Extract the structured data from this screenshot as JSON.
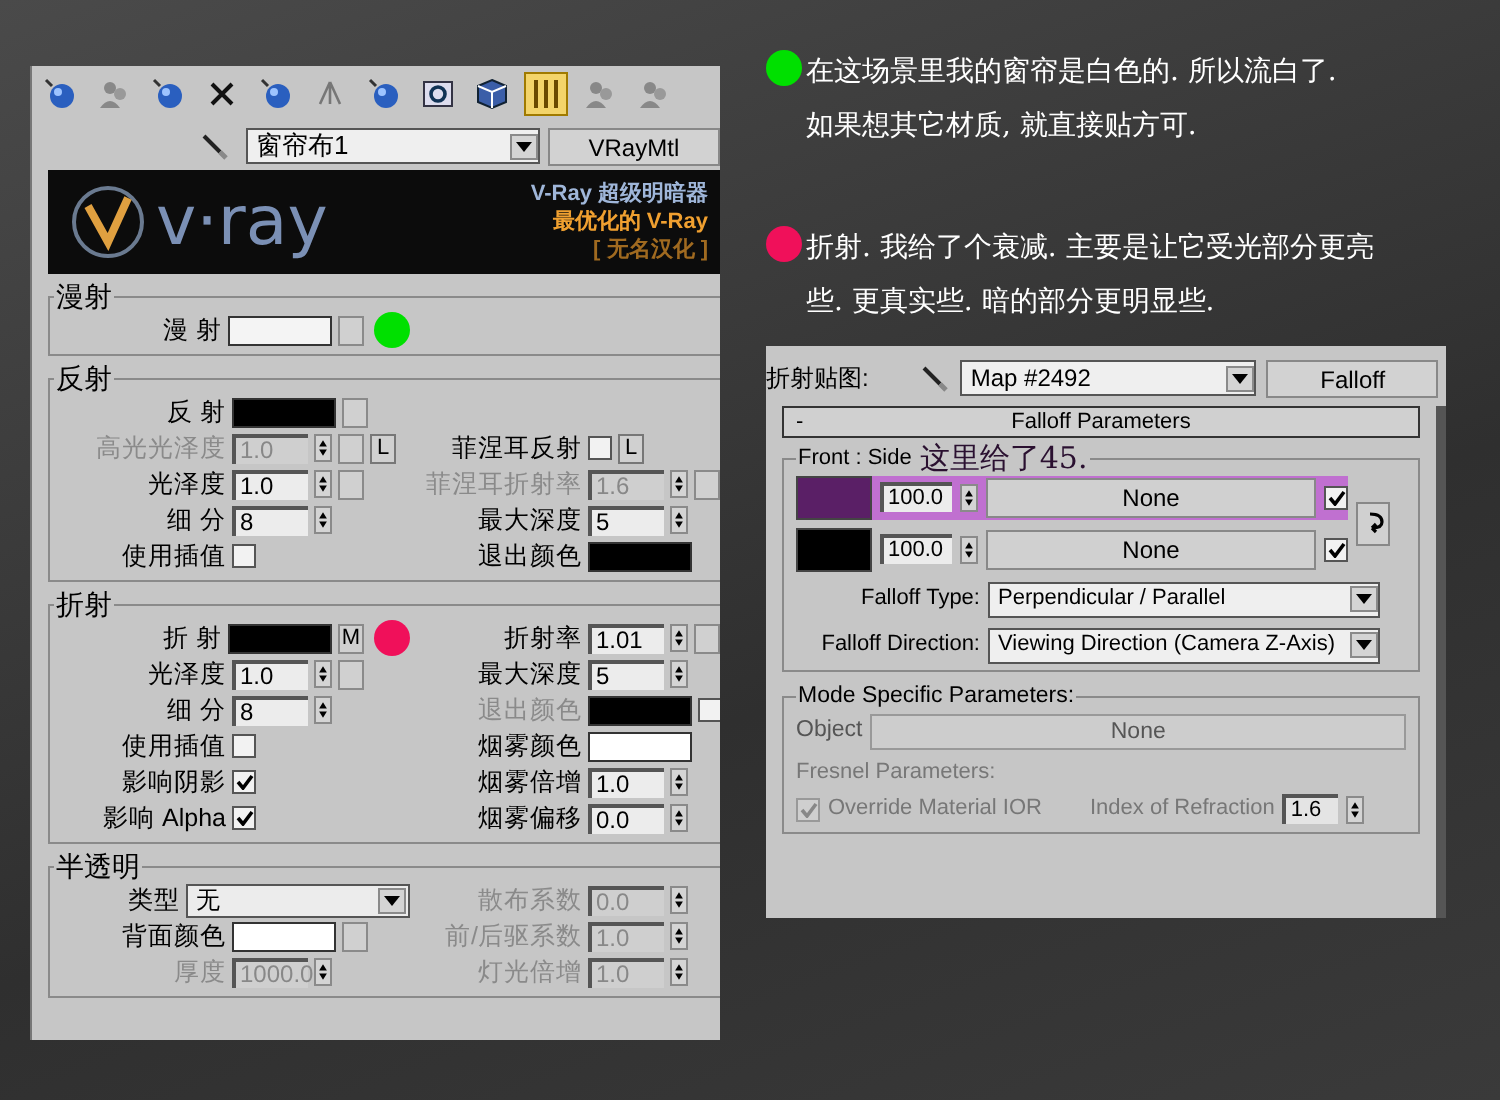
{
  "notes": [
    {
      "color": "#00e000",
      "lines": [
        "在这场景里我的窗帘是白色的. 所以流白了.",
        "如果想其它材质, 就直接贴方可."
      ]
    },
    {
      "color": "#f0105a",
      "lines": [
        "折射. 我给了个衰减. 主要是让它受光部分更亮",
        "些. 更真实些. 暗的部分更明显些."
      ]
    }
  ],
  "toolbar": [
    {
      "kind": "sphere",
      "selected": false
    },
    {
      "kind": "people",
      "selected": false
    },
    {
      "kind": "sphere",
      "selected": false
    },
    {
      "kind": "delete",
      "selected": false
    },
    {
      "kind": "sphere",
      "selected": false
    },
    {
      "kind": "tree",
      "selected": false
    },
    {
      "kind": "sphere",
      "selected": false
    },
    {
      "kind": "box",
      "selected": false
    },
    {
      "kind": "cube",
      "selected": false
    },
    {
      "kind": "bars",
      "selected": true
    },
    {
      "kind": "people",
      "selected": false
    },
    {
      "kind": "people",
      "selected": false
    }
  ],
  "material": {
    "name": "窗帘布1",
    "type": "VRayMtl"
  },
  "banner": {
    "logo": "v·ray",
    "lines": [
      "V-Ray 超级明暗器",
      "最优化的 V-Ray",
      "[ 无名汉化 ]"
    ]
  },
  "sections": [
    {
      "title": "漫射",
      "rows": [
        {
          "left": {
            "kind": "swatch",
            "label": "漫 射",
            "color": "#f4f4f4",
            "map_button": true,
            "marker": {
              "color": "#00e000"
            }
          }
        }
      ]
    },
    {
      "title": "反射",
      "rows": [
        {
          "left": {
            "kind": "swatch",
            "label": "反 射",
            "color": "#000000",
            "map_button": true
          }
        },
        {
          "left": {
            "kind": "spinner",
            "label": "高光光泽度",
            "value": "1.0",
            "disabled": true,
            "map_button": true,
            "lock": "L"
          },
          "right": {
            "kind": "checkbox",
            "label": "菲涅耳反射",
            "checked": false,
            "lock": "L"
          }
        },
        {
          "left": {
            "kind": "spinner",
            "label": "光泽度",
            "value": "1.0",
            "map_button": true
          },
          "right": {
            "kind": "spinner",
            "label": "菲涅耳折射率",
            "value": "1.6",
            "disabled": true,
            "map_button": true
          }
        },
        {
          "left": {
            "kind": "spinner",
            "label": "细 分",
            "value": "8"
          },
          "right": {
            "kind": "spinner",
            "label": "最大深度",
            "value": "5"
          }
        },
        {
          "left": {
            "kind": "checkbox",
            "label": "使用插值",
            "checked": false
          },
          "right": {
            "kind": "swatch",
            "label": "退出颜色",
            "color": "#000000"
          }
        }
      ]
    },
    {
      "title": "折射",
      "rows": [
        {
          "left": {
            "kind": "swatch",
            "label": "折 射",
            "color": "#000000",
            "map_button": true,
            "map_text": "M",
            "marker": {
              "color": "#f0105a"
            }
          },
          "right": {
            "kind": "spinner",
            "label": "折射率",
            "value": "1.01",
            "map_button": true
          }
        },
        {
          "left": {
            "kind": "spinner",
            "label": "光泽度",
            "value": "1.0",
            "map_button": true
          },
          "right": {
            "kind": "spinner",
            "label": "最大深度",
            "value": "5"
          }
        },
        {
          "left": {
            "kind": "spinner",
            "label": "细 分",
            "value": "8"
          },
          "right": {
            "kind": "swatch",
            "label": "退出颜色",
            "color": "#000000",
            "disabled": true,
            "checkbox": false
          }
        },
        {
          "left": {
            "kind": "checkbox",
            "label": "使用插值",
            "checked": false
          },
          "right": {
            "kind": "swatch",
            "label": "烟雾颜色",
            "color": "#ffffff"
          }
        },
        {
          "left": {
            "kind": "checkbox",
            "label": "影响阴影",
            "checked": true
          },
          "right": {
            "kind": "spinner",
            "label": "烟雾倍增",
            "value": "1.0"
          }
        },
        {
          "left": {
            "kind": "checkbox",
            "label": "影响 Alpha",
            "checked": true
          },
          "right": {
            "kind": "spinner",
            "label": "烟雾偏移",
            "value": "0.0"
          }
        }
      ]
    },
    {
      "title": "半透明",
      "rows": [
        {
          "left": {
            "kind": "dropdown",
            "label": "类型",
            "value": "无"
          },
          "right": {
            "kind": "spinner",
            "label": "散布系数",
            "value": "0.0",
            "disabled": true
          }
        },
        {
          "left": {
            "kind": "swatch",
            "label": "背面颜色",
            "color": "#ffffff",
            "map_button": true
          },
          "right": {
            "kind": "spinner",
            "label": "前/后驱系数",
            "value": "1.0",
            "disabled": true
          }
        },
        {
          "left": {
            "kind": "spinner",
            "label": "厚度",
            "value": "1000.0",
            "disabled": true
          },
          "right": {
            "kind": "spinner",
            "label": "灯光倍增",
            "value": "1.0",
            "disabled": true
          }
        }
      ]
    }
  ],
  "map_panel": {
    "label": "折射贴图:",
    "map_name": "Map #2492",
    "map_type": "Falloff",
    "rollout": {
      "sign": "-",
      "title": "Falloff Parameters"
    },
    "group": "Front : Side",
    "annotation": "这里给了45.",
    "rows": [
      {
        "color": "#5a1f66",
        "value": "100.0",
        "map": "None",
        "checked": true,
        "highlighted": true
      },
      {
        "color": "#000000",
        "value": "100.0",
        "map": "None",
        "checked": true,
        "highlighted": false
      }
    ],
    "falloff_type": {
      "label": "Falloff Type:",
      "value": "Perpendicular / Parallel"
    },
    "falloff_direction": {
      "label": "Falloff Direction:",
      "value": "Viewing Direction (Camera Z-Axis)"
    },
    "mode": {
      "title": "Mode Specific Parameters:",
      "object_label": "Object",
      "object_value": "None",
      "fresnel_title": "Fresnel Parameters:",
      "override_label": "Override Material IOR",
      "override_checked": true,
      "ior_label": "Index of Refraction",
      "ior_value": "1.6"
    }
  }
}
